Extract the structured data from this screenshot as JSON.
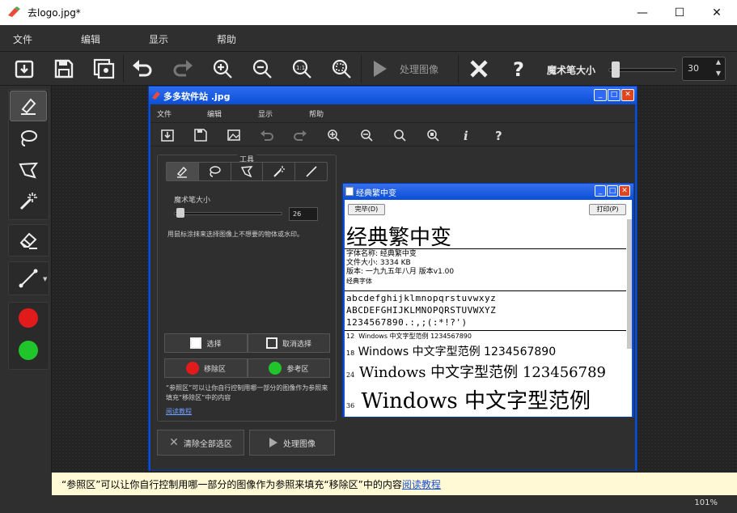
{
  "window": {
    "title": "去logo.jpg*",
    "minimize": "—",
    "maximize": "☐",
    "close": "✕"
  },
  "menu": [
    "文件",
    "编辑",
    "显示",
    "帮助"
  ],
  "toolbar": {
    "process_label": "处理图像",
    "brush_size_label": "魔术笔大小",
    "brush_size_value": "30",
    "brush_size_level": 0.05
  },
  "left_tools": {
    "red_color": "#e11b1b",
    "green_color": "#1fc52a"
  },
  "inner_window": {
    "title": "多多软件站 .jpg",
    "menu": [
      "文件",
      "编辑",
      "显示",
      "帮助"
    ],
    "panel_header": "工具",
    "brush_label": "魔术笔大小",
    "brush_value": "26",
    "hint": "用鼠标涂抹来选择图像上不想要的物体或水印。",
    "select_btn": "选择",
    "deselect_btn": "取消选择",
    "remove_area_btn": "移除区",
    "reference_area_btn": "参考区",
    "ref_desc": "“参照区”可以让你自行控制用哪一部分的图像作为参照来填充“移除区”中的内容",
    "tutorial_link": "阅读教程",
    "clear_all_btn": "清除全部选区",
    "process_btn": "处理图像"
  },
  "font_preview": {
    "title": "经典繁中变",
    "install_btn": "完毕(D)",
    "print_btn": "打印(P)",
    "big_name": "经典繁中变",
    "info": [
      "字体名称: 经典繁中变",
      "文件大小: 3334 KB",
      "版本: 一九九五年八月 版本v1.00",
      "经典字体"
    ],
    "alpha_lower": "abcdefghijklmnopqrstuvwxyz",
    "alpha_upper": "ABCDEFGHIJKLMNOPQRSTUVWXYZ",
    "digits": "1234567890.:,;(:*!?')",
    "sizes": [
      {
        "size": "12",
        "text": "Windows 中文字型范例 1234567890"
      },
      {
        "size": "18",
        "text": "Windows 中文字型范例 1234567890"
      },
      {
        "size": "24",
        "text": "Windows 中文字型范例 123456789"
      },
      {
        "size": "36",
        "text": "Windows 中文字型范例"
      }
    ]
  },
  "hint_bar": {
    "text": "“参照区”可以让你自行控制用哪一部分的图像作为参照来填充“移除区”中的内容",
    "link": "阅读教程"
  },
  "status": {
    "zoom": "101%"
  }
}
